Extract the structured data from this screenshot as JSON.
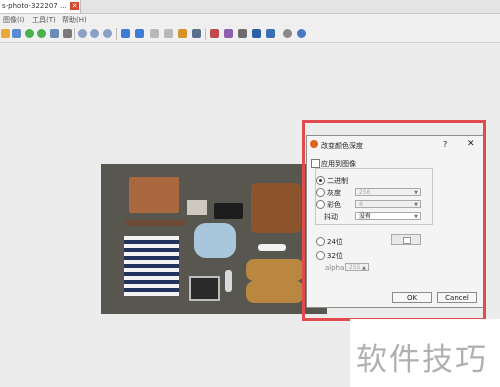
{
  "tab": {
    "title": "s-photo-322207 ...",
    "close_icon": "close-icon"
  },
  "menu": {
    "items": [
      "图像(I)",
      "工具(T)",
      "帮助(H)"
    ]
  },
  "toolbar": {
    "icons": [
      "folder-open-icon",
      "save-icon",
      "refresh-icon",
      "refresh-alt-icon",
      "image-icon",
      "monitor-icon",
      "zoom-in-icon",
      "zoom-fit-icon",
      "zoom-out-icon",
      "arrow-left-icon",
      "arrow-right-icon",
      "first-icon",
      "last-icon",
      "slideshow-icon",
      "fullscreen-icon",
      "crop-icon",
      "paint-icon",
      "print-icon",
      "scan-icon",
      "save-alt-icon",
      "settings-icon",
      "help-icon"
    ]
  },
  "dialog": {
    "title": "改变颜色深度",
    "help": "?",
    "close": "✕",
    "apply_label": "应用到图像",
    "binary_label": "二进制",
    "grayscale_label": "灰度",
    "grayscale_value": "256",
    "color_label": "彩色",
    "color_value": "8",
    "dither_label": "抖动",
    "dither_value": "没有",
    "bit24_label": "24位",
    "bit32_label": "32位",
    "alpha_label": "alpha",
    "alpha_value": "255",
    "ok_label": "OK",
    "cancel_label": "Cancel"
  },
  "watermark": {
    "text": "软件技巧"
  },
  "colors": {
    "highlight": "#e14b4f",
    "tab_close": "#d9462e",
    "photo_bg": "#57564f"
  }
}
